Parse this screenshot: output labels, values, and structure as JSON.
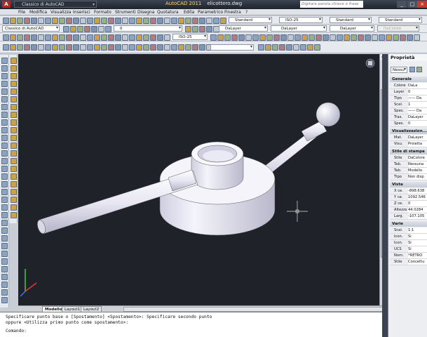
{
  "window": {
    "app_title": "AutoCAD 2011",
    "file_name": "elicottero.dwg",
    "workspace": "Classico di AutoCAD",
    "search_placeholder": "Digitare parola chiave o frase"
  },
  "menu": [
    "File",
    "Modifica",
    "Visualizza",
    "Inserisci",
    "Formato",
    "Strumenti",
    "Disegna",
    "Quotatura",
    "Edita",
    "Parametrico",
    "Finestra",
    "?"
  ],
  "toolbar2": {
    "textstyle": "Standard",
    "dimstyle": "ISO-25",
    "tablestyle": "Standard",
    "multileader": "Standard"
  },
  "toolbar3": {
    "workspace": "Classico di AutoCAD",
    "layer": "0",
    "color": "DaLayer",
    "linetype": "DaLayer",
    "lineweight": "DaLayer",
    "plotstyle": "DaColore"
  },
  "toolbar4": {
    "dimstyle": "ISO-25"
  },
  "tabs": [
    "Modello",
    "Layout1",
    "Layout2"
  ],
  "command": {
    "line1": "Specificare punto base o [Spostamento] <Spostamento>: Specificare secondo punto",
    "line2": "oppure <Utilizza primo punto come spostamento>:",
    "prompt": "Comando:"
  },
  "properties": {
    "title": "Proprietà",
    "selection": "Nessu",
    "sections": [
      {
        "name": "Generale",
        "rows": [
          [
            "Colore",
            "DaLa"
          ],
          [
            "Layer",
            "0"
          ],
          [
            "Tipo",
            "—— Da"
          ],
          [
            "Scal.",
            "1"
          ],
          [
            "Spes.",
            "—— Da"
          ],
          [
            "Tras.",
            "DaLayer"
          ],
          [
            "Spes.",
            "0"
          ]
        ]
      },
      {
        "name": "Visualizzazion...",
        "rows": [
          [
            "Mat.",
            "DaLayer"
          ],
          [
            "Visu.",
            "Proietta"
          ]
        ]
      },
      {
        "name": "Stile di stampa",
        "rows": [
          [
            "Stile",
            "DaColore"
          ],
          [
            "Tab.",
            "Nessuna"
          ],
          [
            "Tab.",
            "Modello"
          ],
          [
            "Tipo",
            "Non disp"
          ]
        ]
      },
      {
        "name": "Vista",
        "rows": [
          [
            "X ce.",
            "-898.638"
          ],
          [
            "Y ce.",
            "1092.546"
          ],
          [
            "Z ce.",
            "0"
          ],
          [
            "Altezza",
            "44.0284"
          ],
          [
            "Larg.",
            "-107.105"
          ]
        ]
      },
      {
        "name": "Varie",
        "rows": [
          [
            "Scal.",
            "1:1"
          ],
          [
            "Icon.",
            "Si"
          ],
          [
            "Icon.",
            "Si"
          ],
          [
            "UCS",
            "Si"
          ],
          [
            "Nom.",
            "*RETRO"
          ],
          [
            "Stile",
            "Concettu"
          ]
        ]
      }
    ]
  },
  "colors": {
    "drawing_bg": "#1f2228",
    "model": "#ecebf5",
    "titlebar": "#1e232c"
  }
}
